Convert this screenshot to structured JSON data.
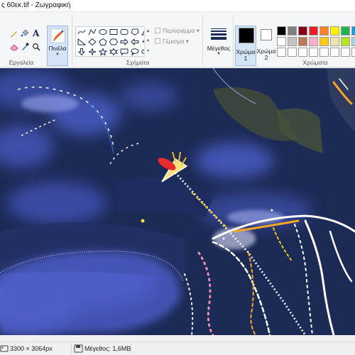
{
  "window": {
    "title": "ς 60εκ.tif - Ζωγραφική"
  },
  "groups": {
    "tools": "Εργαλεία",
    "shapes": "Σχήματα",
    "colors": "Χρώματα"
  },
  "tools": {
    "icons": [
      "pencil-icon",
      "fill-bucket-icon",
      "text-icon",
      "eraser-icon",
      "color-picker-icon",
      "magnifier-icon"
    ]
  },
  "brushes": {
    "label": "Πινέλα",
    "icon": "brush-icon"
  },
  "shape_options": {
    "outline": "Περίγραμμα",
    "fill": "Γέμισμα"
  },
  "size": {
    "label": "Μέγεθος"
  },
  "color1": {
    "label": "Χρώμα 1",
    "value": "#000000"
  },
  "color2": {
    "label": "Χρώμα 2",
    "value": "#ffffff"
  },
  "palette": {
    "row1": [
      "#000000",
      "#7f7f7f",
      "#880015",
      "#ed1c24",
      "#ff7f27",
      "#fff200",
      "#22b14c",
      "#00a2e8"
    ],
    "row2": [
      "#ffffff",
      "#c3c3c3",
      "#b97a57",
      "#ffaec9",
      "#ffc90e",
      "#efe4b0",
      "#b5e61d",
      "#99d9ea"
    ],
    "row3": [
      "#ffffff",
      "#ffffff",
      "#ffffff",
      "#ffffff",
      "#ffffff",
      "#ffffff",
      "#ffffff",
      "#ffffff"
    ]
  },
  "status": {
    "dimensions": "3300 × 3064px",
    "file_size": "Μέγεθος: 1,6MB"
  }
}
